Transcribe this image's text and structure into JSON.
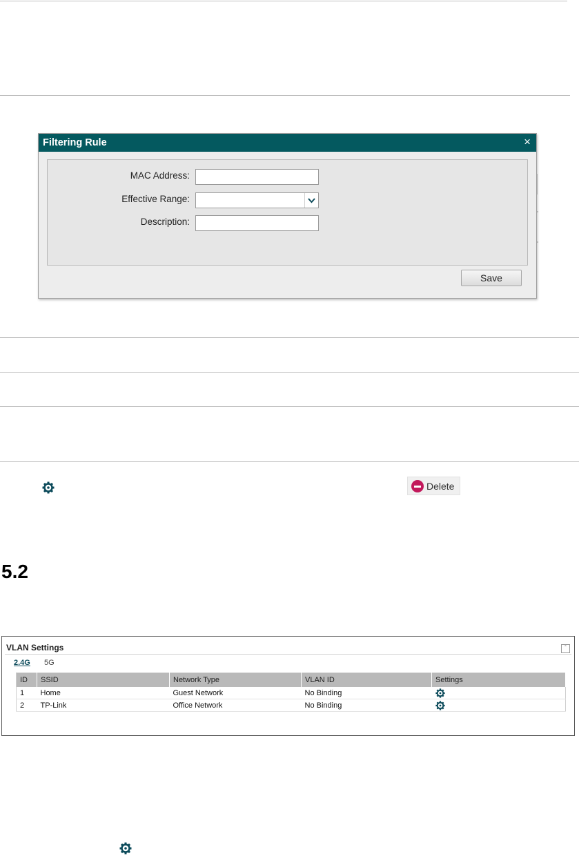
{
  "dialog": {
    "title": "Filtering Rule",
    "close_glyph": "×",
    "fields": {
      "mac_label": "MAC Address:",
      "mac_value": "",
      "range_label": "Effective Range:",
      "range_value": "",
      "description_label": "Description:",
      "description_value": ""
    },
    "save_label": "Save"
  },
  "toolbar": {
    "delete_label": "Delete"
  },
  "section": {
    "number": "5.2"
  },
  "vlan": {
    "title": "VLAN Settings",
    "bands": [
      "2.4G",
      "5G"
    ],
    "columns": [
      "ID",
      "SSID",
      "Network Type",
      "VLAN ID",
      "Settings"
    ],
    "rows": [
      {
        "id": "1",
        "ssid": "Home",
        "network_type": "Guest Network",
        "vlan_id": "No Binding"
      },
      {
        "id": "2",
        "ssid": "TP-Link",
        "network_type": "Office Network",
        "vlan_id": "No Binding"
      }
    ]
  },
  "colors": {
    "title_bar": "#04595f",
    "icon_teal": "#0b4a5a",
    "delete_red": "#c2185b"
  },
  "icons": [
    "gear-icon",
    "close-icon",
    "chevron-down-icon",
    "delete-icon",
    "collapse-icon"
  ]
}
